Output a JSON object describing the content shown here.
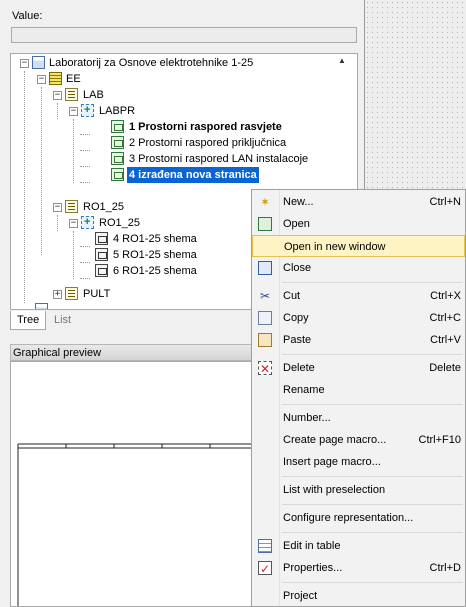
{
  "value_panel": {
    "label": "Value:",
    "value": ""
  },
  "tree": {
    "nodes": [
      {
        "label": "Laboratorij za Osnove elektrotehnike 1-25",
        "expander": "−",
        "icon": "project-icon"
      },
      {
        "label": "EE",
        "expander": "−",
        "icon": "function-icon"
      },
      {
        "label": "LAB",
        "expander": "−",
        "icon": "structure-icon"
      },
      {
        "label": "LABPR",
        "expander": "−",
        "icon": "location-icon"
      },
      {
        "label": "1 Prostorni raspored rasvjete",
        "icon": "page-icon"
      },
      {
        "label": "2 Prostorni raspored priključnica",
        "icon": "page-icon"
      },
      {
        "label": "3 Prostorni raspored LAN instalacoje",
        "icon": "page-icon"
      },
      {
        "label": "4 izrađena nova stranica",
        "icon": "page-icon"
      },
      {
        "label": "RO1_25",
        "expander": "−",
        "icon": "structure-icon"
      },
      {
        "label": "RO1_25",
        "expander": "−",
        "icon": "location-icon"
      },
      {
        "label": "4 RO1-25 shema",
        "icon": "schematic-icon"
      },
      {
        "label": "5 RO1-25 shema",
        "icon": "schematic-icon"
      },
      {
        "label": "6 RO1-25 shema",
        "icon": "schematic-icon"
      },
      {
        "label": "PULT",
        "expander": "+",
        "icon": "structure-icon"
      }
    ],
    "scroll_up": "▲"
  },
  "tabs": [
    {
      "label": "Tree"
    },
    {
      "label": "List"
    }
  ],
  "preview": {
    "title": "Graphical preview"
  },
  "context_menu": {
    "items": [
      {
        "label": "New...",
        "shortcut": "Ctrl+N",
        "icon": "new-page-icon"
      },
      {
        "label": "Open",
        "shortcut": "",
        "icon": "open-icon"
      },
      {
        "label": "Open in new window",
        "shortcut": "",
        "icon": ""
      },
      {
        "label": "Close",
        "shortcut": "",
        "icon": "close-page-icon"
      },
      {
        "label": "Cut",
        "shortcut": "Ctrl+X",
        "icon": "scissors-icon"
      },
      {
        "label": "Copy",
        "shortcut": "Ctrl+C",
        "icon": "copy-icon"
      },
      {
        "label": "Paste",
        "shortcut": "Ctrl+V",
        "icon": "paste-icon"
      },
      {
        "label": "Delete",
        "shortcut": "Delete",
        "icon": "delete-icon"
      },
      {
        "label": "Rename",
        "shortcut": "",
        "icon": ""
      },
      {
        "label": "Number...",
        "shortcut": "",
        "icon": ""
      },
      {
        "label": "Create page macro...",
        "shortcut": "Ctrl+F10",
        "icon": ""
      },
      {
        "label": "Insert page macro...",
        "shortcut": "",
        "icon": ""
      },
      {
        "label": "List with preselection",
        "shortcut": "",
        "icon": ""
      },
      {
        "label": "Configure representation...",
        "shortcut": "",
        "icon": ""
      },
      {
        "label": "Edit in table",
        "shortcut": "",
        "icon": "table-icon"
      },
      {
        "label": "Properties...",
        "shortcut": "Ctrl+D",
        "icon": "properties-icon"
      },
      {
        "label": "Project",
        "shortcut": "",
        "icon": ""
      }
    ],
    "highlighted_item": "Open in new window"
  },
  "colors": {
    "selection": "#0a64d4",
    "highlight": "#fdf3c3",
    "highlight_border": "#e6c24a"
  }
}
